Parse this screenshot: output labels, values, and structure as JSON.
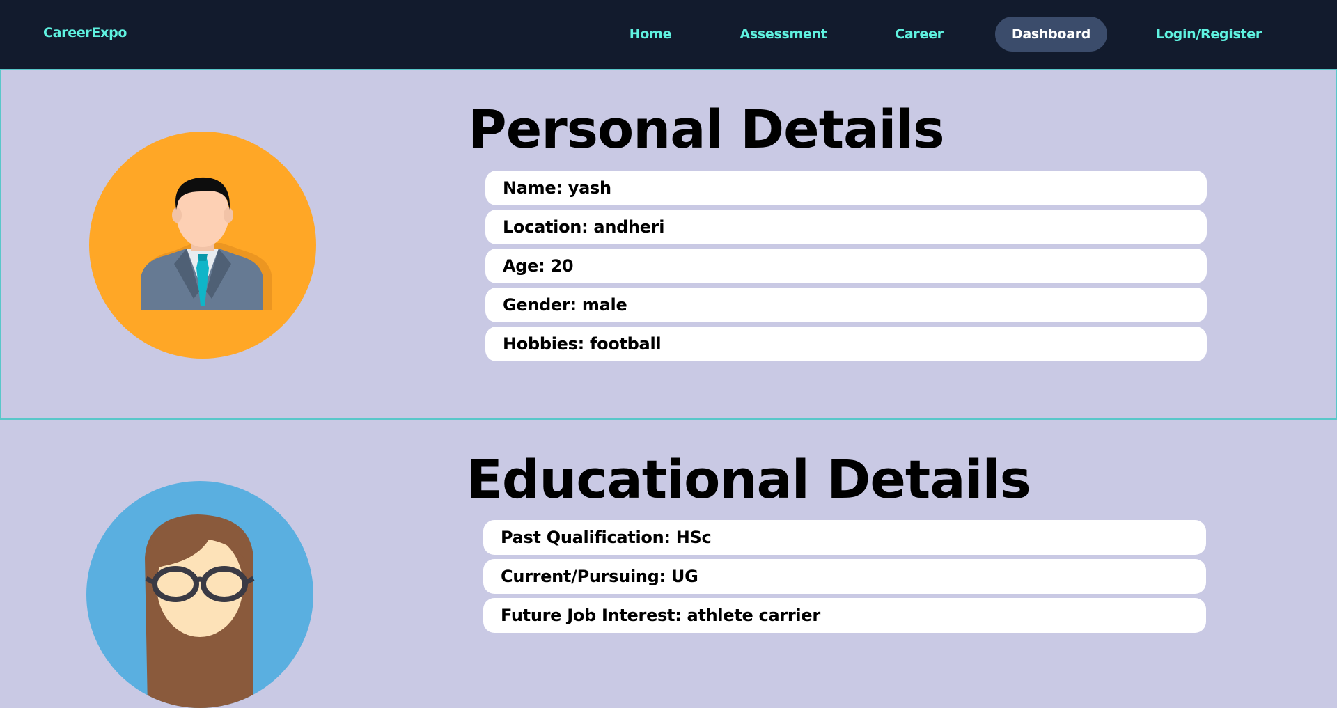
{
  "nav": {
    "brand": "CareerExpo",
    "links": [
      {
        "label": "Home"
      },
      {
        "label": "Assessment"
      },
      {
        "label": "Career"
      },
      {
        "label": "Dashboard",
        "active": true
      },
      {
        "label": "Login/Register"
      }
    ]
  },
  "personal": {
    "title": "Personal Details",
    "rows": [
      "Name: yash",
      "Location: andheri",
      "Age: 20",
      "Gender: male",
      "Hobbies: football"
    ],
    "avatar_icon": "male-avatar-icon"
  },
  "education": {
    "title": "Educational Details",
    "rows": [
      "Past Qualification: HSc",
      "Current/Pursuing: UG",
      "Future Job Interest: athlete carrier"
    ],
    "avatar_icon": "female-avatar-icon"
  },
  "colors": {
    "nav_bg": "#121b2d",
    "nav_text": "#5ff2e0",
    "active_pill": "#3b4c6b",
    "page_bg": "#c9c9e4",
    "section_border": "#59c7c9",
    "male_avatar_bg": "#ffa726",
    "female_avatar_bg": "#5aafe0"
  }
}
